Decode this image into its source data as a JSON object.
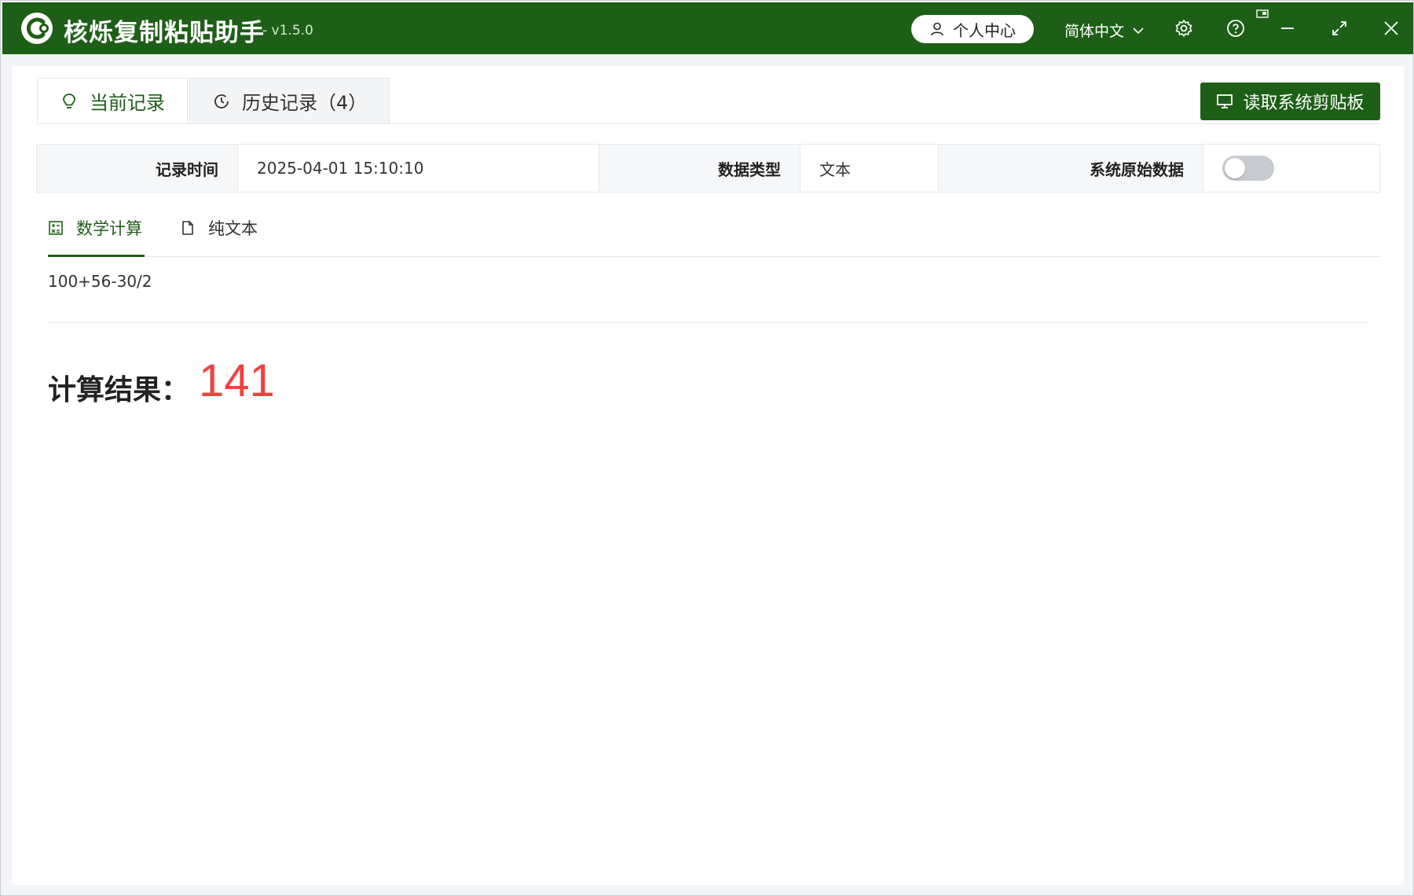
{
  "app": {
    "title": "核烁复制粘贴助手",
    "version": "- v1.5.0"
  },
  "titlebar": {
    "user_center": "个人中心",
    "language": "简体中文",
    "icons": [
      "user-icon",
      "chevron-down-icon",
      "gear-icon",
      "help-icon",
      "minimize-icon",
      "maximize-icon",
      "close-icon"
    ]
  },
  "tabs": [
    {
      "label": "当前记录",
      "icon": "lightbulb-icon",
      "active": true
    },
    {
      "label": "历史记录（4）",
      "icon": "clock-icon",
      "active": false
    }
  ],
  "read_clipboard_button": "读取系统剪贴板",
  "info": {
    "record_time_label": "记录时间",
    "record_time_value": "2025-04-01 15:10:10",
    "data_type_label": "数据类型",
    "data_type_value": "文本",
    "raw_data_label": "系统原始数据",
    "raw_data_enabled": false
  },
  "subtabs": [
    {
      "label": "数学计算",
      "icon": "calculator-icon",
      "active": true
    },
    {
      "label": "纯文本",
      "icon": "document-icon",
      "active": false
    }
  ],
  "expression": "100+56-30/2",
  "result_label": "计算结果：",
  "result_value": "141",
  "colors": {
    "brand_green": "#1e5f17",
    "result_red": "#f0413e"
  }
}
